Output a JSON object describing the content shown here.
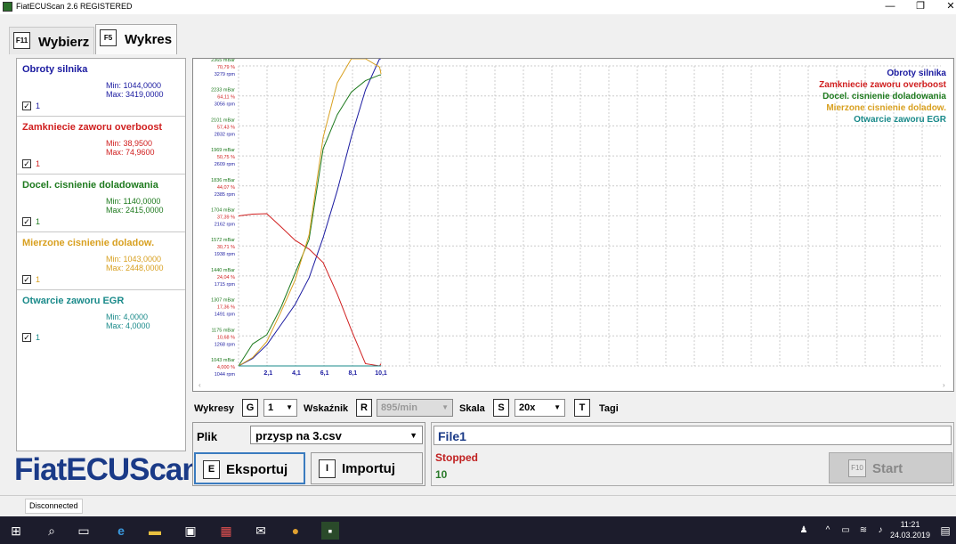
{
  "window": {
    "title": "FiatECUScan 2.6 REGISTERED",
    "min": "—",
    "max": "❐",
    "close": "✕"
  },
  "tabs": [
    {
      "key": "F11",
      "label": "Wybierz"
    },
    {
      "key": "F5",
      "label": "Wykres"
    }
  ],
  "channels": [
    {
      "name": "Obroty silnika",
      "min": "Min: 1044,0000",
      "max": "Max: 3419,0000",
      "checked": "1",
      "color": "#1a1aa0"
    },
    {
      "name": "Zamkniecie zaworu overboost",
      "min": "Min: 38,9500",
      "max": "Max: 74,9600",
      "checked": "1",
      "color": "#d02020"
    },
    {
      "name": "Docel. cisnienie doladowania",
      "min": "Min: 1140,0000",
      "max": "Max: 2415,0000",
      "checked": "1",
      "color": "#1e7a1e"
    },
    {
      "name": "Mierzone cisnienie doladow.",
      "min": "Min: 1043,0000",
      "max": "Max: 2448,0000",
      "checked": "1",
      "color": "#d8a020"
    },
    {
      "name": "Otwarcie zaworu EGR",
      "min": "Min: 4,0000",
      "max": "Max: 4,0000",
      "checked": "1",
      "color": "#1a8a8a"
    }
  ],
  "logo": "FiatECUScan",
  "chart_data": {
    "type": "line",
    "x": [
      0,
      1,
      2,
      3,
      4,
      5,
      6,
      7,
      8,
      9,
      10,
      10.1
    ],
    "xticks": [
      "2,1",
      "4,1",
      "6,1",
      "8,1",
      "10,1"
    ],
    "yticks": [
      [
        "2365 mBar",
        "70,79 %",
        "3279 rpm"
      ],
      [
        "2233 mBar",
        "64,11 %",
        "3056 rpm"
      ],
      [
        "2101 mBar",
        "57,43 %",
        "2832 rpm"
      ],
      [
        "1969 mBar",
        "50,75 %",
        "2609 rpm"
      ],
      [
        "1836 mBar",
        "44,07 %",
        "2385 rpm"
      ],
      [
        "1704 mBar",
        "37,39 %",
        "2162 rpm"
      ],
      [
        "1572 mBar",
        "30,71 %",
        "1938 rpm"
      ],
      [
        "1440 mBar",
        "24,04 %",
        "1715 rpm"
      ],
      [
        "1307 mBar",
        "17,36 %",
        "1491 rpm"
      ],
      [
        "1175 mBar",
        "10,68 %",
        "1268 rpm"
      ],
      [
        "1043 mBar",
        "4,000 %",
        "1044 rpm"
      ]
    ],
    "series": [
      {
        "name": "Obroty silnika",
        "color": "#1a1aa0",
        "values": [
          1044,
          1100,
          1200,
          1350,
          1500,
          1700,
          2000,
          2350,
          2750,
          3100,
          3419,
          3419
        ],
        "unit": "rpm",
        "range": [
          1044,
          3279
        ]
      },
      {
        "name": "Zamkniecie zaworu overboost",
        "color": "#d02020",
        "values": [
          37.4,
          37.8,
          37.9,
          35,
          32,
          30,
          27,
          20,
          12,
          4.5,
          4,
          4.5
        ],
        "unit": "%",
        "range": [
          4,
          70.79
        ]
      },
      {
        "name": "Docel. cisnienie doladowania",
        "color": "#1e7a1e",
        "values": [
          1043,
          1140,
          1180,
          1300,
          1450,
          1600,
          2000,
          2150,
          2250,
          2300,
          2325,
          2325
        ],
        "unit": "mBar",
        "range": [
          1043,
          2365
        ]
      },
      {
        "name": "Mierzone cisnienie doladow.",
        "color": "#d8a020",
        "values": [
          1043,
          1080,
          1150,
          1280,
          1420,
          1620,
          2050,
          2290,
          2448,
          2440,
          2360,
          2330
        ],
        "unit": "mBar",
        "range": [
          1043,
          2365
        ]
      },
      {
        "name": "Otwarcie zaworu EGR",
        "color": "#1a8a8a",
        "values": [
          4,
          4,
          4,
          4,
          4,
          4,
          4,
          4,
          4,
          4,
          4,
          4
        ],
        "unit": "%",
        "range": [
          4,
          70.79
        ]
      }
    ],
    "grid": true,
    "legend": "top-right"
  },
  "controls": {
    "wykresy_label": "Wykresy",
    "wykresy_key": "G",
    "wykresy_value": "1",
    "wskaznik_label": "Wskaźnik",
    "wskaznik_key": "R",
    "wskaznik_value": "895/min",
    "skala_label": "Skala",
    "skala_key": "S",
    "skala_value": "20x",
    "tagi_key": "T",
    "tagi_label": "Tagi"
  },
  "file": {
    "label": "Plik",
    "value": "przysp na 3.csv"
  },
  "buttons": {
    "export_key": "E",
    "export_label": "Eksportuj",
    "import_key": "I",
    "import_label": "Importuj",
    "start_key": "F10",
    "start_label": "Start"
  },
  "status": {
    "file_name": "File1",
    "state": "Stopped",
    "count": "10",
    "connection": "Disconnected"
  },
  "taskbar": {
    "time": "11:21",
    "date": "24.03.2019"
  }
}
